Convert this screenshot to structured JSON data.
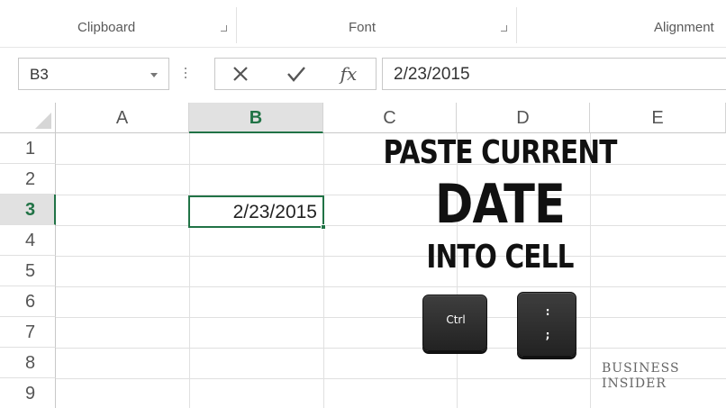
{
  "ribbon": {
    "groups": [
      "Clipboard",
      "Font",
      "Alignment"
    ]
  },
  "formula_bar": {
    "name_box": "B3",
    "cancel_icon": "x-icon",
    "enter_icon": "check-icon",
    "function_icon": "fx-icon",
    "fx_label": "fx",
    "formula_value": "2/23/2015"
  },
  "grid": {
    "columns": [
      "A",
      "B",
      "C",
      "D",
      "E"
    ],
    "rows": [
      "1",
      "2",
      "3",
      "4",
      "5",
      "6",
      "7",
      "8",
      "9"
    ],
    "selected_column": "B",
    "selected_row": "3",
    "active_cell_value": "2/23/2015"
  },
  "overlay": {
    "line1": "PASTE CURRENT",
    "line2": "DATE",
    "line3": "INTO CELL"
  },
  "keys": {
    "ctrl_label": "Ctrl",
    "semicolon_top": ":",
    "semicolon_bottom": ";"
  },
  "watermark": {
    "line1": "BUSINESS",
    "line2": "INSIDER"
  },
  "colors": {
    "accent_green": "#217346",
    "header_selected_bg": "#e1e1e1",
    "key_dark": "#2a2a2a"
  }
}
